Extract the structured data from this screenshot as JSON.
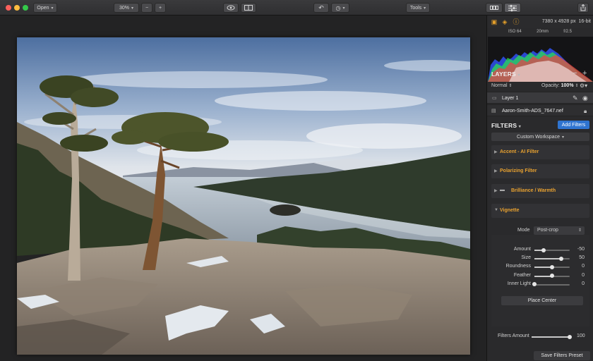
{
  "toolbar": {
    "open_label": "Open",
    "zoom_label": "30%",
    "zoom_out": "−",
    "zoom_in": "+",
    "tools_label": "Tools"
  },
  "info": {
    "dimensions": "7380 x 4928 px",
    "bit_depth": "16-bit",
    "iso": "ISO 64",
    "focal": "20mm",
    "aperture": "f/2.5"
  },
  "layers": {
    "title": "LAYERS",
    "blend_mode": "Normal",
    "opacity_label": "Opacity:",
    "opacity_value": "100%",
    "items": [
      {
        "name": "Layer 1"
      },
      {
        "name": "Aaron-Smith-ADS_7647.nef"
      }
    ]
  },
  "filters": {
    "title": "FILTERS",
    "add_label": "Add Filters",
    "workspace_label": "Custom Workspace",
    "list": [
      {
        "name": "Accent - AI Filter"
      },
      {
        "name": "Polarizing Filter"
      },
      {
        "name": "Brilliance / Warmth"
      },
      {
        "name": "Vignette"
      }
    ],
    "vignette": {
      "mode_label": "Mode",
      "mode_value": "Post-crop",
      "sliders": [
        {
          "label": "Amount",
          "value": "-50",
          "level": 0.25
        },
        {
          "label": "Size",
          "value": "50",
          "level": 0.75
        },
        {
          "label": "Roundness",
          "value": "0",
          "level": 0.5
        },
        {
          "label": "Feather",
          "value": "0",
          "level": 0.5
        },
        {
          "label": "Inner Light",
          "value": "0",
          "level": 0.0
        }
      ],
      "place_center": "Place Center"
    },
    "amount_label": "Filters Amount",
    "amount_value": "100",
    "amount_level": 1.0,
    "save_preset": "Save Filters Preset"
  },
  "colors": {
    "accent": "#e9a230",
    "primary_button": "#2f74d0"
  }
}
